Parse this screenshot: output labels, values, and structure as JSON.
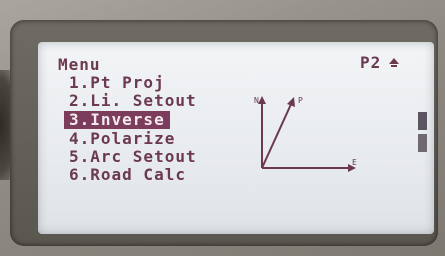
{
  "header": {
    "title": "Menu",
    "page": "P2"
  },
  "menu": {
    "items": [
      {
        "label": "1.Pt Proj"
      },
      {
        "label": "2.Li. Setout"
      },
      {
        "label": "3.Inverse",
        "selected": true
      },
      {
        "label": "4.Polarize"
      },
      {
        "label": "5.Arc Setout"
      },
      {
        "label": "6.Road Calc"
      }
    ]
  },
  "diagram": {
    "north_label": "N",
    "azimuth_label": "P",
    "east_label": "E"
  },
  "colors": {
    "text": "#6b3950",
    "highlight": "#7b3d5b",
    "lcd_bg": "#eef0f2"
  },
  "icons": {
    "scroll_up": "up-arrow-icon",
    "scrollbar": "scrollbar"
  }
}
